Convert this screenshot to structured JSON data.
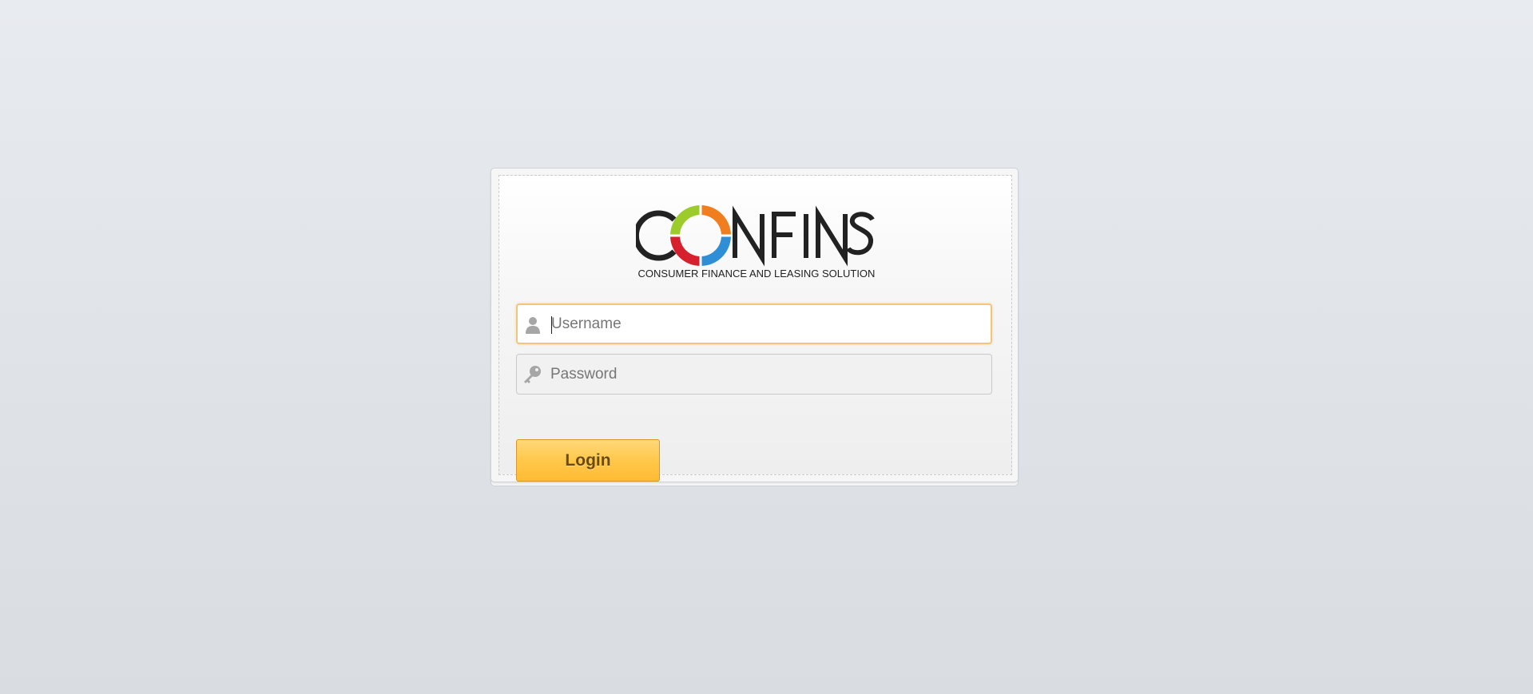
{
  "logo": {
    "brand": "CONFINS",
    "tagline": "CONSUMER FINANCE AND LEASING SOLUTION",
    "ring_colors": [
      "#f07d1e",
      "#2e8fd6",
      "#d6202e",
      "#9ccc2c"
    ]
  },
  "form": {
    "username": {
      "placeholder": "Username",
      "value": "",
      "icon": "user-icon"
    },
    "password": {
      "placeholder": "Password",
      "value": "",
      "icon": "key-icon"
    },
    "login_label": "Login"
  },
  "colors": {
    "button_gradient_top": "#ffd87a",
    "button_gradient_bottom": "#ffbb34",
    "focus_border": "#f2c47c"
  }
}
